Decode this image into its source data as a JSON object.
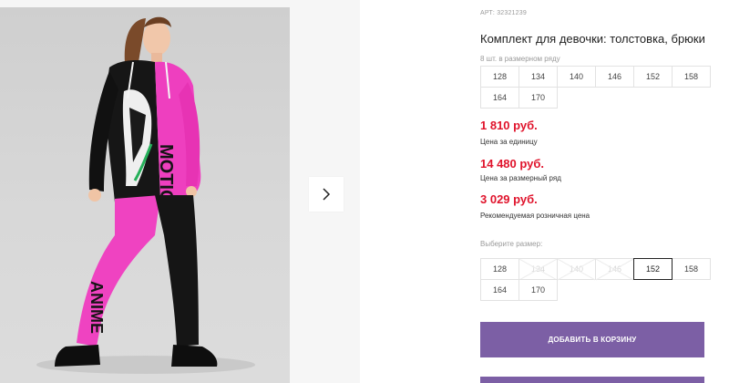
{
  "gallery": {
    "image_alt": "Photo of girl wearing black and pink hoodie and pants set",
    "print_text_top": "MOTION",
    "print_text_bottom": "ANIME",
    "next_icon": "chevron-right-icon"
  },
  "product": {
    "article": "АРТ: 32321239",
    "title": "Комплект для девочки: толстовка, брюки",
    "pack_hint": "8 шт. в размерном ряду",
    "pack_sizes": [
      "128",
      "134",
      "140",
      "146",
      "152",
      "158",
      "164",
      "170"
    ]
  },
  "prices": [
    {
      "amount": "1 810 руб.",
      "label": "Цена за единицу"
    },
    {
      "amount": "14 480 руб.",
      "label": "Цена за размерный ряд"
    },
    {
      "amount": "3 029 руб.",
      "label": "Рекомендуемая розничная цена"
    }
  ],
  "size_select": {
    "hint": "Выберите размер:",
    "options": [
      {
        "label": "128",
        "state": "available"
      },
      {
        "label": "134",
        "state": "unavailable"
      },
      {
        "label": "140",
        "state": "unavailable"
      },
      {
        "label": "146",
        "state": "unavailable"
      },
      {
        "label": "152",
        "state": "selected"
      },
      {
        "label": "158",
        "state": "available"
      },
      {
        "label": "164",
        "state": "available"
      },
      {
        "label": "170",
        "state": "available"
      }
    ]
  },
  "actions": {
    "add_to_cart": "ДОБАВИТЬ В КОРЗИНУ",
    "accent_color": "#7c5fa5",
    "price_color": "#e0142c"
  }
}
